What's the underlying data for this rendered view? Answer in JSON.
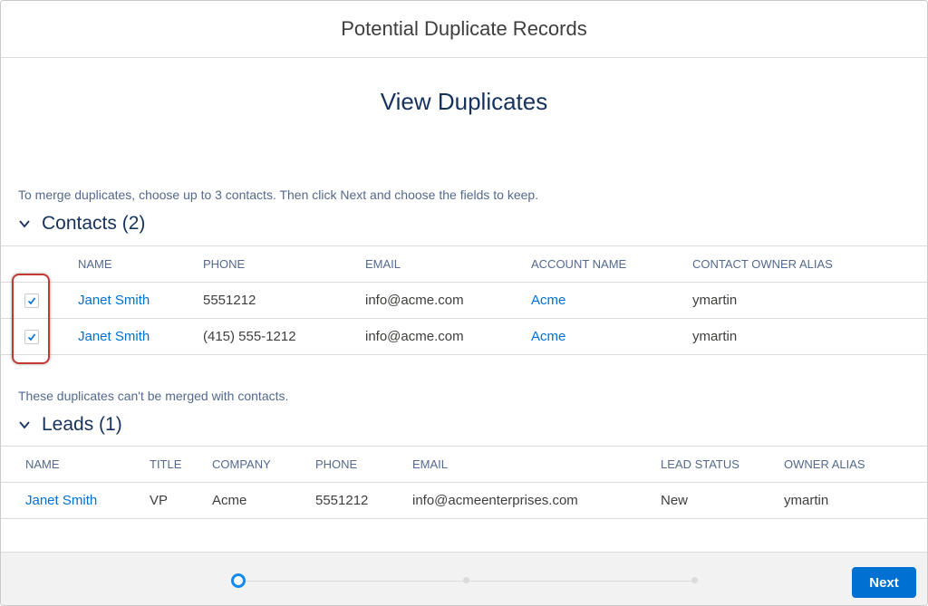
{
  "modal": {
    "header_title": "Potential Duplicate Records",
    "page_title": "View Duplicates",
    "instruction": "To merge duplicates, choose up to 3 contacts. Then click Next and choose the fields to keep."
  },
  "contacts": {
    "section_label": "Contacts (2)",
    "columns": [
      "NAME",
      "PHONE",
      "EMAIL",
      "ACCOUNT NAME",
      "CONTACT OWNER ALIAS"
    ],
    "rows": [
      {
        "name": "Janet Smith",
        "phone": "5551212",
        "email": "info@acme.com",
        "account": "Acme",
        "owner": "ymartin",
        "selected": true
      },
      {
        "name": "Janet Smith",
        "phone": "(415) 555-1212",
        "email": "info@acme.com",
        "account": "Acme",
        "owner": "ymartin",
        "selected": true
      }
    ]
  },
  "leads": {
    "note": "These duplicates can't be merged with contacts.",
    "section_label": "Leads (1)",
    "columns": [
      "NAME",
      "TITLE",
      "COMPANY",
      "PHONE",
      "EMAIL",
      "LEAD STATUS",
      "OWNER ALIAS"
    ],
    "rows": [
      {
        "name": "Janet Smith",
        "title": "VP",
        "company": "Acme",
        "phone": "5551212",
        "email": "info@acmeenterprises.com",
        "status": "New",
        "owner": "ymartin"
      }
    ]
  },
  "footer": {
    "next_label": "Next",
    "progress": {
      "current_step": 1,
      "total_steps": 3
    }
  },
  "colors": {
    "brand": "#0070d2",
    "link": "#0070d2",
    "highlight": "#c23934",
    "title": "#16325c"
  }
}
